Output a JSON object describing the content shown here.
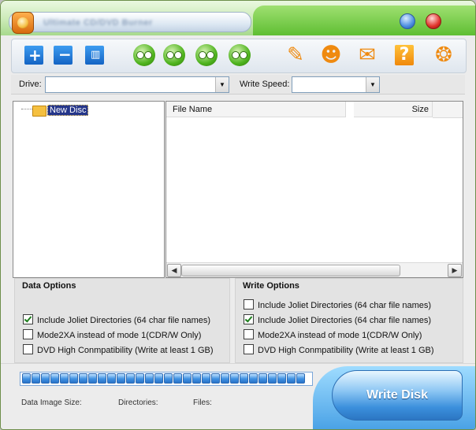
{
  "window": {
    "title": "Ultimate CD/DVD Burner"
  },
  "toolbar": {
    "buttons": [
      {
        "name": "add-file-icon"
      },
      {
        "name": "remove-file-icon"
      },
      {
        "name": "clear-list-icon"
      },
      {
        "name": "burn-data-disc-icon"
      },
      {
        "name": "burn-iso-icon"
      },
      {
        "name": "burn-audio-icon"
      },
      {
        "name": "erase-disc-icon"
      },
      {
        "name": "register-icon"
      },
      {
        "name": "user-icon"
      },
      {
        "name": "email-icon"
      },
      {
        "name": "help-icon"
      },
      {
        "name": "about-icon"
      }
    ],
    "help_glyph": "?"
  },
  "drivebar": {
    "drive_label": "Drive:",
    "drive_value": "",
    "speed_label": "Write Speed:",
    "speed_value": ""
  },
  "tree": {
    "root_label": "New Disc"
  },
  "filelist": {
    "columns": [
      "File Name",
      "Size"
    ],
    "rows": []
  },
  "data_options": {
    "title": "Data Options",
    "items": [
      {
        "label": "Include Joliet Directories (64 char file names)",
        "checked": true
      },
      {
        "label": "Mode2XA instead of mode 1(CDR/W Only)",
        "checked": false
      },
      {
        "label": "DVD High Conmpatibility (Write at least 1 GB)",
        "checked": false
      }
    ]
  },
  "write_options": {
    "title": "Write Options",
    "items": [
      {
        "label": "Include Joliet Directories (64 char file names)",
        "checked": false
      },
      {
        "label": "Include Joliet Directories (64 char file names)",
        "checked": true
      },
      {
        "label": "Mode2XA instead of mode 1(CDR/W Only)",
        "checked": false
      },
      {
        "label": "DVD High Conmpatibility (Write at least 1 GB)",
        "checked": false
      }
    ]
  },
  "progress": {
    "segments": 30,
    "filled_fraction": 1.0
  },
  "status": {
    "image_size_label": "Data Image Size:",
    "directories_label": "Directories:",
    "files_label": "Files:"
  },
  "write_button": {
    "label": "Write Disk"
  },
  "colors": {
    "accent_blue": "#3b8fdc",
    "title_green": "#5fbe33"
  }
}
